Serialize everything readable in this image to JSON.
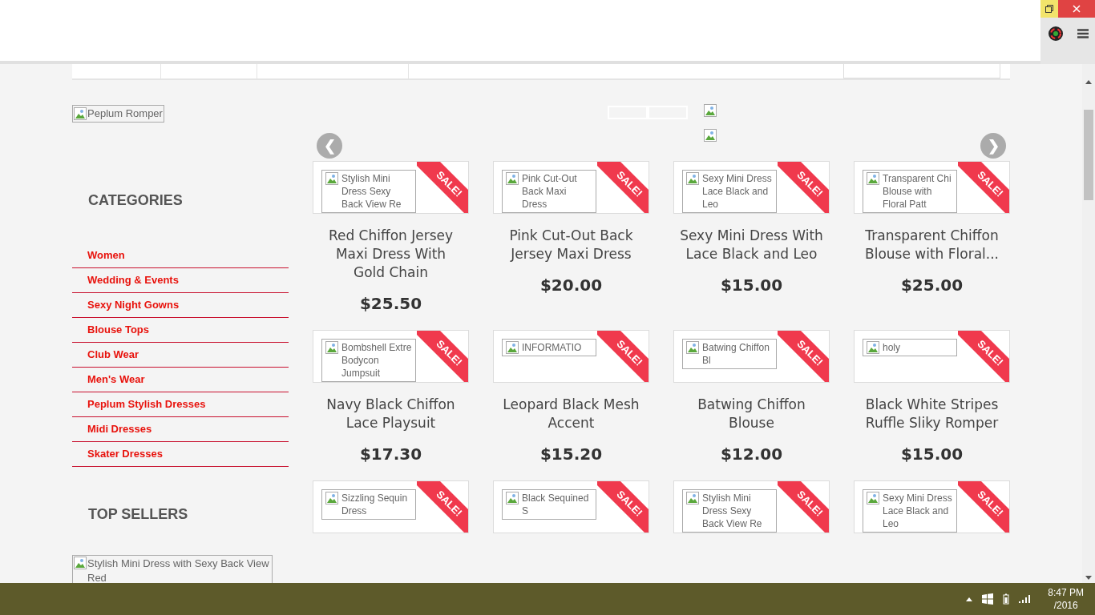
{
  "sidebar": {
    "banner_alt": "Peplum Romper",
    "categories_title": "CATEGORIES",
    "categories": [
      {
        "label": "Women"
      },
      {
        "label": "Wedding & Events"
      },
      {
        "label": "Sexy Night Gowns"
      },
      {
        "label": "Blouse Tops"
      },
      {
        "label": "Club Wear"
      },
      {
        "label": "Men's Wear"
      },
      {
        "label": "Peplum Stylish Dresses"
      },
      {
        "label": "Midi Dresses"
      },
      {
        "label": "Skater Dresses"
      }
    ],
    "top_sellers_title": "TOP SELLERS",
    "top_seller_alt": "Stylish Mini Dress with Sexy Back View Red"
  },
  "carousel": {
    "prev": "❮",
    "next": "❯"
  },
  "products": [
    {
      "image_alt": "Stylish Mini Dress Sexy Back View Re",
      "badge": "SALE!",
      "name": "Red Chiffon Jersey Maxi Dress With Gold Chain",
      "price": "$25.50"
    },
    {
      "image_alt": "Pink Cut-Out Back Maxi Dress",
      "badge": "SALE!",
      "name": "Pink Cut-Out Back Jersey Maxi Dress",
      "price": "$20.00"
    },
    {
      "image_alt": "Sexy Mini Dress Lace Black and Leo",
      "badge": "SALE!",
      "name": "Sexy Mini Dress With Lace Black and Leo",
      "price": "$15.00"
    },
    {
      "image_alt": "Transparent Chi Blouse with Floral Patt",
      "badge": "SALE!",
      "name": "Transparent Chiffon Blouse with Floral...",
      "price": "$25.00"
    },
    {
      "image_alt": "Bombshell Extre Bodycon Jumpsuit",
      "badge": "SALE!",
      "name": "Navy Black Chiffon Lace Playsuit",
      "price": "$17.30"
    },
    {
      "image_alt": "INFORMATIO",
      "badge": "SALE!",
      "name": "Leopard Black Mesh Accent",
      "price": "$15.20"
    },
    {
      "image_alt": "Batwing Chiffon Bl",
      "badge": "SALE!",
      "name": "Batwing Chiffon Blouse",
      "price": "$12.00"
    },
    {
      "image_alt": "holy",
      "badge": "SALE!",
      "name": "Black White Stripes Ruffle Sliky Romper",
      "price": "$15.00"
    },
    {
      "image_alt": "Sizzling Sequin Dress",
      "badge": "SALE!"
    },
    {
      "image_alt": "Black Sequined S",
      "badge": "SALE!"
    },
    {
      "image_alt": "Stylish Mini Dress Sexy Back View Re",
      "badge": "SALE!"
    },
    {
      "image_alt": "Sexy Mini Dress Lace Black and Leo",
      "badge": "SALE!"
    }
  ],
  "taskbar": {
    "time": "8:47 PM",
    "date": "/2016"
  }
}
